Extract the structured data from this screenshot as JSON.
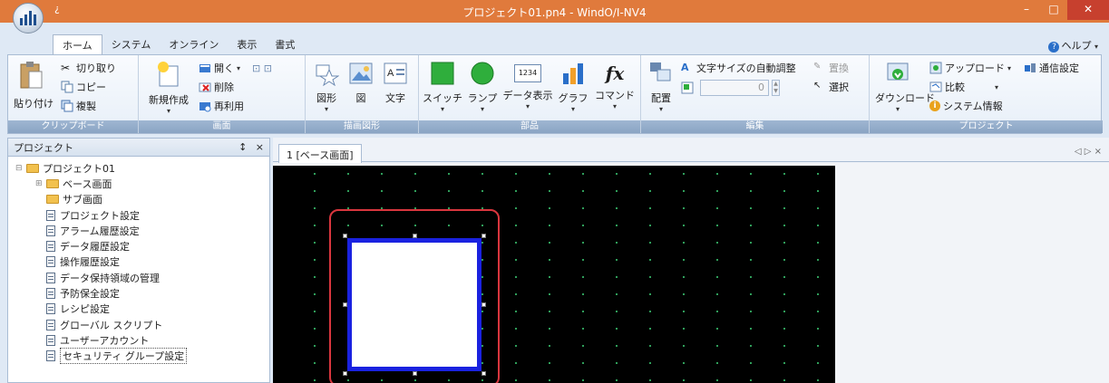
{
  "window": {
    "title": "プロジェクト01.pn4 - WindO/I-NV4",
    "qat_symbol": "¿",
    "controls": {
      "minimize": "–",
      "maximize": "□",
      "close": "✕"
    }
  },
  "tabs": [
    "ホーム",
    "システム",
    "オンライン",
    "表示",
    "書式"
  ],
  "active_tab": "ホーム",
  "help_label": "ヘルプ",
  "ribbon": {
    "clipboard": {
      "label": "クリップボード",
      "paste": "貼り付け",
      "cut": "切り取り",
      "copy": "コピー",
      "duplicate": "複製"
    },
    "screen": {
      "label": "画面",
      "new": "新規作成",
      "open": "開く",
      "delete": "削除",
      "reuse": "再利用"
    },
    "drawing": {
      "label": "描画図形",
      "shape": "図形",
      "figure": "図",
      "text": "文字"
    },
    "parts": {
      "label": "部品",
      "switch": "スイッチ",
      "lamp": "ランプ",
      "data_display": "データ表示",
      "data_display_icon": "1234",
      "graph": "グラフ",
      "command": "コマンド",
      "command_icon": "fx"
    },
    "edit": {
      "label": "編集",
      "arrange": "配置",
      "auto_font": "文字サイズの自動調整",
      "font_size_value": "0",
      "replace": "置換",
      "select": "選択"
    },
    "project": {
      "label": "プロジェクト",
      "download": "ダウンロード",
      "upload": "アップロード",
      "compare": "比較",
      "comm_settings": "通信設定",
      "system_info": "システム情報"
    }
  },
  "project_panel": {
    "title": "プロジェクト",
    "pin": "↕",
    "close": "×",
    "items": [
      {
        "label": "プロジェクト01",
        "type": "folder",
        "guide": "⊟"
      },
      {
        "label": "ベース画面",
        "type": "folder",
        "guide": "⊞"
      },
      {
        "label": "サブ画面",
        "type": "folder",
        "guide": ""
      },
      {
        "label": "プロジェクト設定",
        "type": "doc",
        "guide": ""
      },
      {
        "label": "アラーム履歴設定",
        "type": "doc",
        "guide": ""
      },
      {
        "label": "データ履歴設定",
        "type": "doc",
        "guide": ""
      },
      {
        "label": "操作履歴設定",
        "type": "doc",
        "guide": ""
      },
      {
        "label": "データ保持領域の管理",
        "type": "doc",
        "guide": ""
      },
      {
        "label": "予防保全設定",
        "type": "doc",
        "guide": ""
      },
      {
        "label": "レシピ設定",
        "type": "doc",
        "guide": ""
      },
      {
        "label": "グローバル スクリプト",
        "type": "doc",
        "guide": ""
      },
      {
        "label": "ユーザーアカウント",
        "type": "doc",
        "guide": ""
      },
      {
        "label": "セキュリティ グループ設定",
        "type": "doc",
        "guide": ""
      }
    ]
  },
  "document_tab": {
    "label": "1  [ベース画面]",
    "controls": "◁ ▷ ×"
  },
  "colors": {
    "titlebar": "#e07a3c",
    "screen_bg": "#000000",
    "shape_border": "#1a22e0",
    "selection_ring": "#d9363e",
    "grid_dot": "#2f9e5a"
  }
}
